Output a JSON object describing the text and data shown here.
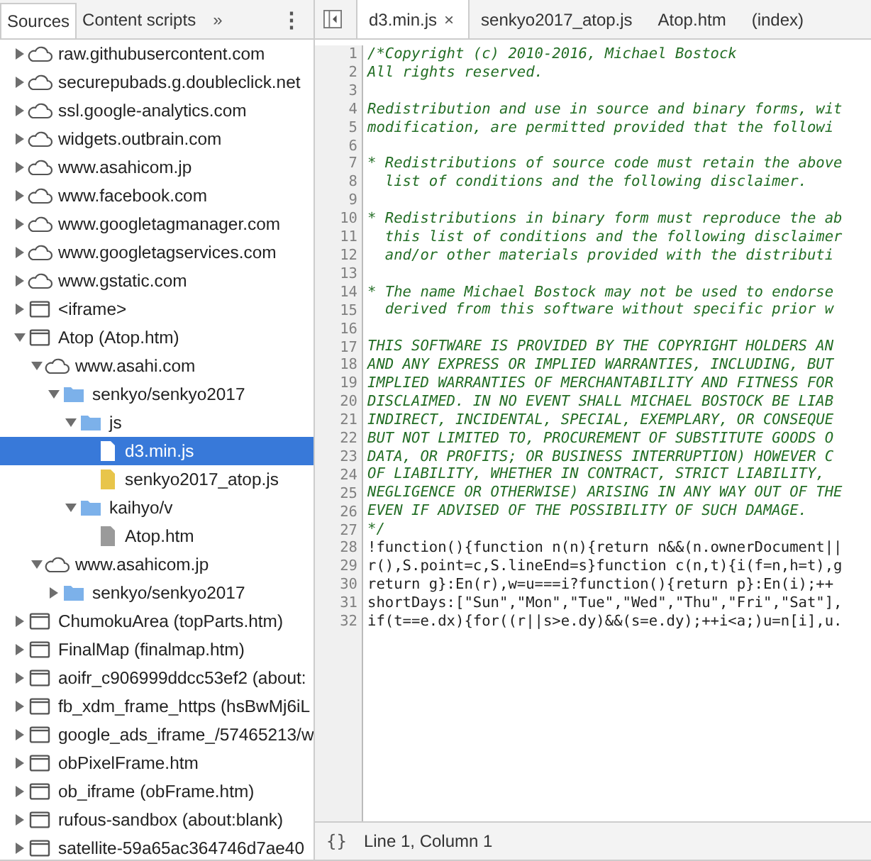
{
  "navigator": {
    "tabs": [
      {
        "label": "Sources",
        "selected": true
      },
      {
        "label": "Content scripts",
        "selected": false
      }
    ],
    "more_tabs": "»",
    "menu": "⋮",
    "tree": [
      {
        "kind": "domain",
        "label": "raw.githubusercontent.com",
        "expanded": false,
        "selected": false
      },
      {
        "kind": "domain",
        "label": "securepubads.g.doubleclick.net",
        "expanded": false,
        "selected": false
      },
      {
        "kind": "domain",
        "label": "ssl.google-analytics.com",
        "expanded": false,
        "selected": false
      },
      {
        "kind": "domain",
        "label": "widgets.outbrain.com",
        "expanded": false,
        "selected": false
      },
      {
        "kind": "domain",
        "label": "www.asahicom.jp",
        "expanded": false,
        "selected": false
      },
      {
        "kind": "domain",
        "label": "www.facebook.com",
        "expanded": false,
        "selected": false
      },
      {
        "kind": "domain",
        "label": "www.googletagmanager.com",
        "expanded": false,
        "selected": false
      },
      {
        "kind": "domain",
        "label": "www.googletagservices.com",
        "expanded": false,
        "selected": false
      },
      {
        "kind": "domain",
        "label": "www.gstatic.com",
        "expanded": false,
        "selected": false
      },
      {
        "kind": "frame",
        "label": "<iframe>",
        "expanded": false,
        "selected": false
      },
      {
        "kind": "frame",
        "label": "Atop (Atop.htm)",
        "expanded": true,
        "selected": false,
        "children": [
          {
            "kind": "domain",
            "label": "www.asahi.com",
            "expanded": true,
            "selected": false,
            "children": [
              {
                "kind": "folder",
                "label": "senkyo/senkyo2017",
                "expanded": true,
                "selected": false,
                "children": [
                  {
                    "kind": "folder",
                    "label": "js",
                    "expanded": true,
                    "selected": false,
                    "children": [
                      {
                        "kind": "script",
                        "label": "d3.min.js",
                        "selected": true
                      },
                      {
                        "kind": "script",
                        "label": "senkyo2017_atop.js",
                        "selected": false
                      }
                    ]
                  },
                  {
                    "kind": "folder",
                    "label": "kaihyo/v",
                    "expanded": true,
                    "selected": false,
                    "children": [
                      {
                        "kind": "document",
                        "label": "Atop.htm",
                        "selected": false
                      }
                    ]
                  }
                ]
              }
            ]
          },
          {
            "kind": "domain",
            "label": "www.asahicom.jp",
            "expanded": true,
            "selected": false,
            "children": [
              {
                "kind": "folder",
                "label": "senkyo/senkyo2017",
                "expanded": false,
                "selected": false
              }
            ]
          }
        ]
      },
      {
        "kind": "frame",
        "label": "ChumokuArea (topParts.htm)",
        "expanded": false,
        "selected": false
      },
      {
        "kind": "frame",
        "label": "FinalMap (finalmap.htm)",
        "expanded": false,
        "selected": false
      },
      {
        "kind": "frame",
        "label": "aoifr_c906999ddcc53ef2 (about:",
        "expanded": false,
        "selected": false
      },
      {
        "kind": "frame",
        "label": "fb_xdm_frame_https (hsBwMj6iL",
        "expanded": false,
        "selected": false
      },
      {
        "kind": "frame",
        "label": "google_ads_iframe_/57465213/w",
        "expanded": false,
        "selected": false
      },
      {
        "kind": "frame",
        "label": "obPixelFrame.htm",
        "expanded": false,
        "selected": false
      },
      {
        "kind": "frame",
        "label": "ob_iframe (obFrame.htm)",
        "expanded": false,
        "selected": false
      },
      {
        "kind": "frame",
        "label": "rufous-sandbox (about:blank)",
        "expanded": false,
        "selected": false
      },
      {
        "kind": "frame",
        "label": "satellite-59a65ac364746d7ae40",
        "expanded": false,
        "selected": false
      }
    ]
  },
  "editor": {
    "tabs": [
      {
        "label": "d3.min.js",
        "close": "×",
        "selected": true
      },
      {
        "label": "senkyo2017_atop.js",
        "selected": false
      },
      {
        "label": "Atop.htm",
        "selected": false
      },
      {
        "label": "(index)",
        "selected": false
      }
    ],
    "lines": [
      {
        "number": "1",
        "kind": "comment",
        "text": "/*Copyright (c) 2010-2016, Michael Bostock"
      },
      {
        "number": "2",
        "kind": "comment",
        "text": "All rights reserved."
      },
      {
        "number": "3"
      },
      {
        "number": "4",
        "kind": "comment",
        "text": "Redistribution and use in source and binary forms, wit"
      },
      {
        "number": "5",
        "kind": "comment",
        "text": "modification, are permitted provided that the followi"
      },
      {
        "number": "6"
      },
      {
        "number": "7",
        "kind": "comment",
        "text": "* Redistributions of source code must retain the above"
      },
      {
        "number": "8",
        "kind": "comment",
        "text": "  list of conditions and the following disclaimer."
      },
      {
        "number": "9"
      },
      {
        "number": "10",
        "kind": "comment",
        "text": "* Redistributions in binary form must reproduce the ab"
      },
      {
        "number": "11",
        "kind": "comment",
        "text": "  this list of conditions and the following disclaimer"
      },
      {
        "number": "12",
        "kind": "comment",
        "text": "  and/or other materials provided with the distributi"
      },
      {
        "number": "13"
      },
      {
        "number": "14",
        "kind": "comment",
        "text": "* The name Michael Bostock may not be used to endorse"
      },
      {
        "number": "15",
        "kind": "comment",
        "text": "  derived from this software without specific prior w"
      },
      {
        "number": "16"
      },
      {
        "number": "17",
        "kind": "comment",
        "text": "THIS SOFTWARE IS PROVIDED BY THE COPYRIGHT HOLDERS AN"
      },
      {
        "number": "18",
        "kind": "comment",
        "text": "AND ANY EXPRESS OR IMPLIED WARRANTIES, INCLUDING, BUT"
      },
      {
        "number": "19",
        "kind": "comment",
        "text": "IMPLIED WARRANTIES OF MERCHANTABILITY AND FITNESS FOR"
      },
      {
        "number": "20",
        "kind": "comment",
        "text": "DISCLAIMED. IN NO EVENT SHALL MICHAEL BOSTOCK BE LIAB"
      },
      {
        "number": "21",
        "kind": "comment",
        "text": "INDIRECT, INCIDENTAL, SPECIAL, EXEMPLARY, OR CONSEQUE"
      },
      {
        "number": "22",
        "kind": "comment",
        "text": "BUT NOT LIMITED TO, PROCUREMENT OF SUBSTITUTE GOODS O"
      },
      {
        "number": "23",
        "kind": "comment",
        "text": "DATA, OR PROFITS; OR BUSINESS INTERRUPTION) HOWEVER C"
      },
      {
        "number": "24",
        "kind": "comment",
        "text": "OF LIABILITY, WHETHER IN CONTRACT, STRICT LIABILITY,"
      },
      {
        "number": "25",
        "kind": "comment",
        "text": "NEGLIGENCE OR OTHERWISE) ARISING IN ANY WAY OUT OF THE"
      },
      {
        "number": "26",
        "kind": "comment",
        "text": "EVEN IF ADVISED OF THE POSSIBILITY OF SUCH DAMAGE."
      },
      {
        "number": "27",
        "kind": "comment",
        "text": "*/"
      },
      {
        "number": "28",
        "kind": "code",
        "text": "!function(){function n(n){return n&&(n.ownerDocument||"
      },
      {
        "number": "29",
        "kind": "code",
        "text": "r(),S.point=c,S.lineEnd=s}function c(n,t){i(f=n,h=t),g"
      },
      {
        "number": "30",
        "kind": "code",
        "text": "return g}:En(r),w=u===i?function(){return p}:En(i);++"
      },
      {
        "number": "31",
        "kind": "code",
        "text": "shortDays:[\"Sun\",\"Mon\",\"Tue\",\"Wed\",\"Thu\",\"Fri\",\"Sat\"],"
      },
      {
        "number": "32",
        "kind": "code",
        "text": "if(t==e.dx){for((r||s>e.dy)&&(s=e.dy);++i<a;)u=n[i],u."
      }
    ]
  },
  "status_bar": {
    "format_button": "{}",
    "position": "Line 1, Column 1"
  }
}
